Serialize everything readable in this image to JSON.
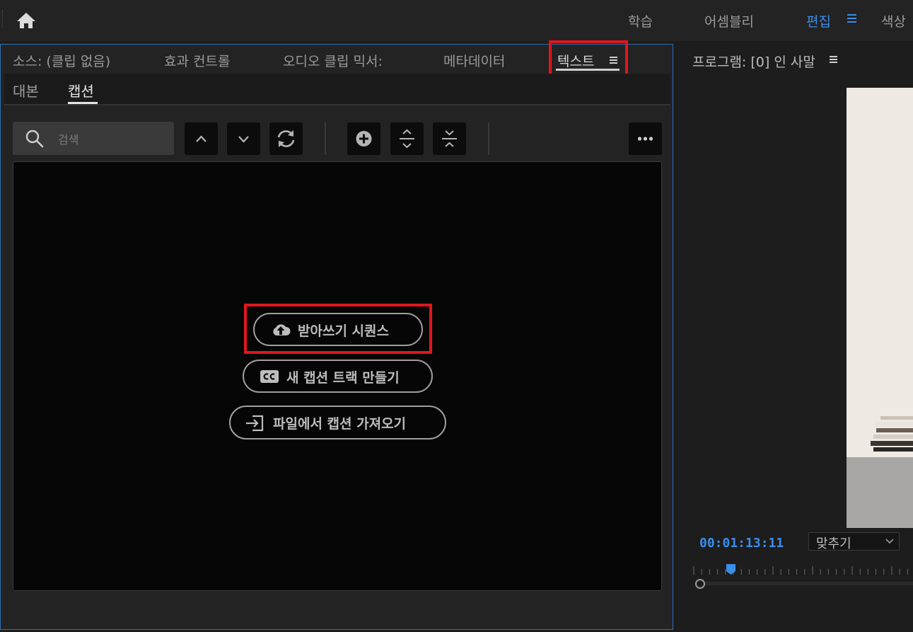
{
  "topbar": {
    "workspaces": [
      "학습",
      "어셈블리",
      "편집",
      "색상"
    ],
    "active_workspace": "편집",
    "accent_color": "#3b8eea"
  },
  "panel_tabs": [
    "소스: (클립 없음)",
    "효과 컨트롤",
    "오디오 클립 믹서:",
    "메타데이터",
    "텍스트"
  ],
  "active_panel_tab": "텍스트",
  "sub_tabs": [
    "대본",
    "캡션"
  ],
  "active_sub_tab": "캡션",
  "search": {
    "placeholder": "검색"
  },
  "toolbar_icons": [
    "chevron-up-icon",
    "chevron-down-icon",
    "refresh-icon",
    "add-circle-icon",
    "expand-icon",
    "collapse-icon",
    "more-icon"
  ],
  "caption_actions": {
    "transcribe": "받아쓰기 시퀀스",
    "new_track": "새 캡션 트랙 만들기",
    "import_file": "파일에서 캡션 가져오기"
  },
  "program": {
    "title": "프로그램: [0] 인 사말",
    "timecode": "00:01:13:11",
    "fit": "맞추기"
  },
  "highlight_color": "#e0161e"
}
